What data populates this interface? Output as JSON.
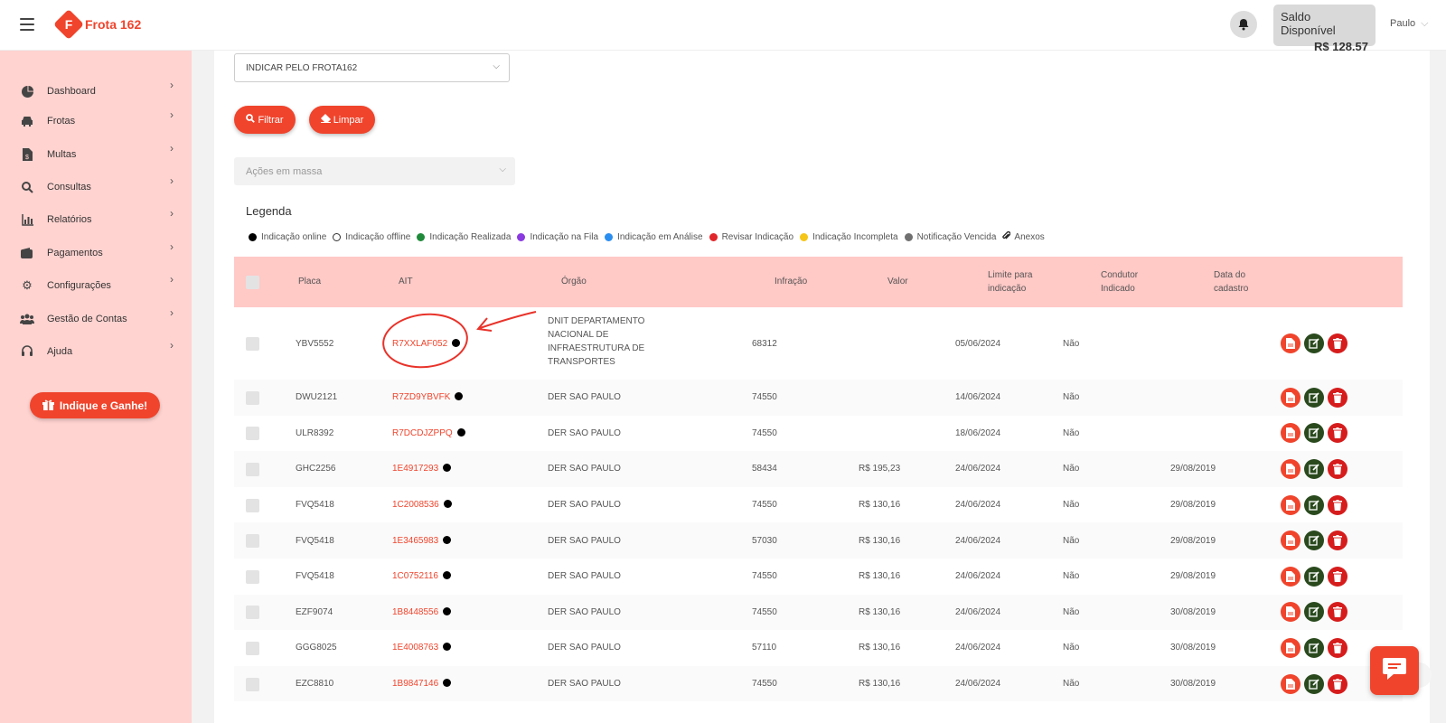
{
  "header": {
    "brand": "Frota 162",
    "brand_letter": "F",
    "saldo_label": "Saldo Disponível",
    "saldo_value": "R$ 128,57",
    "user_name": "Paulo"
  },
  "sidebar": {
    "items": [
      {
        "label": "Dashboard",
        "icon": "pie-chart-icon"
      },
      {
        "label": "Frotas",
        "icon": "car-icon"
      },
      {
        "label": "Multas",
        "icon": "document-dollar-icon"
      },
      {
        "label": "Consultas",
        "icon": "search-icon"
      },
      {
        "label": "Relatórios",
        "icon": "bar-chart-icon"
      },
      {
        "label": "Pagamentos",
        "icon": "wallet-icon"
      },
      {
        "label": "Configurações",
        "icon": "gear-icon"
      },
      {
        "label": "Gestão de Contas",
        "icon": "users-icon"
      },
      {
        "label": "Ajuda",
        "icon": "headset-icon"
      }
    ],
    "cta_label": "Indique e Ganhe!"
  },
  "filters": {
    "indicar_select": "INDICAR PELO FROTA162",
    "filtrar_label": "Filtrar",
    "limpar_label": "Limpar",
    "acoes_placeholder": "Ações em massa"
  },
  "legend": {
    "title": "Legenda",
    "items": [
      {
        "label": "Indicação online",
        "color": "#000000"
      },
      {
        "label": "Indicação offline",
        "color": "#ffffff"
      },
      {
        "label": "Indicação Realizada",
        "color": "#1f8a3a"
      },
      {
        "label": "Indicação na Fila",
        "color": "#8a3ae0"
      },
      {
        "label": "Indicação em Análise",
        "color": "#2a8ef0"
      },
      {
        "label": "Revisar Indicação",
        "color": "#e0262a"
      },
      {
        "label": "Indicação Incompleta",
        "color": "#f5c518"
      },
      {
        "label": "Notificação Vencida",
        "color": "#707070"
      },
      {
        "label": "Anexos",
        "color": "paperclip-icon"
      }
    ]
  },
  "table": {
    "headers": {
      "placa": "Placa",
      "ait": "AIT",
      "orgao": "Órgão",
      "infracao": "Infração",
      "valor": "Valor",
      "limite": "Limite para indicação",
      "condutor": "Condutor Indicado",
      "data": "Data do cadastro"
    },
    "rows": [
      {
        "placa": "YBV5552",
        "ait": "R7XXLAF052",
        "orgao": "DNIT DEPARTAMENTO NACIONAL DE INFRAESTRUTURA DE TRANSPORTES",
        "infracao": "68312",
        "valor": "",
        "limite": "05/06/2024",
        "condutor": "Não",
        "data": ""
      },
      {
        "placa": "DWU2121",
        "ait": "R7ZD9YBVFK",
        "orgao": "DER SAO PAULO",
        "infracao": "74550",
        "valor": "",
        "limite": "14/06/2024",
        "condutor": "Não",
        "data": ""
      },
      {
        "placa": "ULR8392",
        "ait": "R7DCDJZPPQ",
        "orgao": "DER SAO PAULO",
        "infracao": "74550",
        "valor": "",
        "limite": "18/06/2024",
        "condutor": "Não",
        "data": ""
      },
      {
        "placa": "GHC2256",
        "ait": "1E4917293",
        "orgao": "DER SAO PAULO",
        "infracao": "58434",
        "valor": "R$ 195,23",
        "limite": "24/06/2024",
        "condutor": "Não",
        "data": "29/08/2019"
      },
      {
        "placa": "FVQ5418",
        "ait": "1C2008536",
        "orgao": "DER SAO PAULO",
        "infracao": "74550",
        "valor": "R$ 130,16",
        "limite": "24/06/2024",
        "condutor": "Não",
        "data": "29/08/2019"
      },
      {
        "placa": "FVQ5418",
        "ait": "1E3465983",
        "orgao": "DER SAO PAULO",
        "infracao": "57030",
        "valor": "R$ 130,16",
        "limite": "24/06/2024",
        "condutor": "Não",
        "data": "29/08/2019"
      },
      {
        "placa": "FVQ5418",
        "ait": "1C0752116",
        "orgao": "DER SAO PAULO",
        "infracao": "74550",
        "valor": "R$ 130,16",
        "limite": "24/06/2024",
        "condutor": "Não",
        "data": "29/08/2019"
      },
      {
        "placa": "EZF9074",
        "ait": "1B8448556",
        "orgao": "DER SAO PAULO",
        "infracao": "74550",
        "valor": "R$ 130,16",
        "limite": "24/06/2024",
        "condutor": "Não",
        "data": "30/08/2019"
      },
      {
        "placa": "GGG8025",
        "ait": "1E4008763",
        "orgao": "DER SAO PAULO",
        "infracao": "57110",
        "valor": "R$ 130,16",
        "limite": "24/06/2024",
        "condutor": "Não",
        "data": "30/08/2019"
      },
      {
        "placa": "EZC8810",
        "ait": "1B9847146",
        "orgao": "DER SAO PAULO",
        "infracao": "74550",
        "valor": "R$ 130,16",
        "limite": "24/06/2024",
        "condutor": "Não",
        "data": "30/08/2019"
      }
    ]
  },
  "colors": {
    "brand": "#f0442c",
    "sidebar_bg": "#ffd3d0",
    "table_header_bg": "#ffc9c6",
    "edit_action": "#2a4a1e",
    "delete_action": "#d61c1c"
  }
}
